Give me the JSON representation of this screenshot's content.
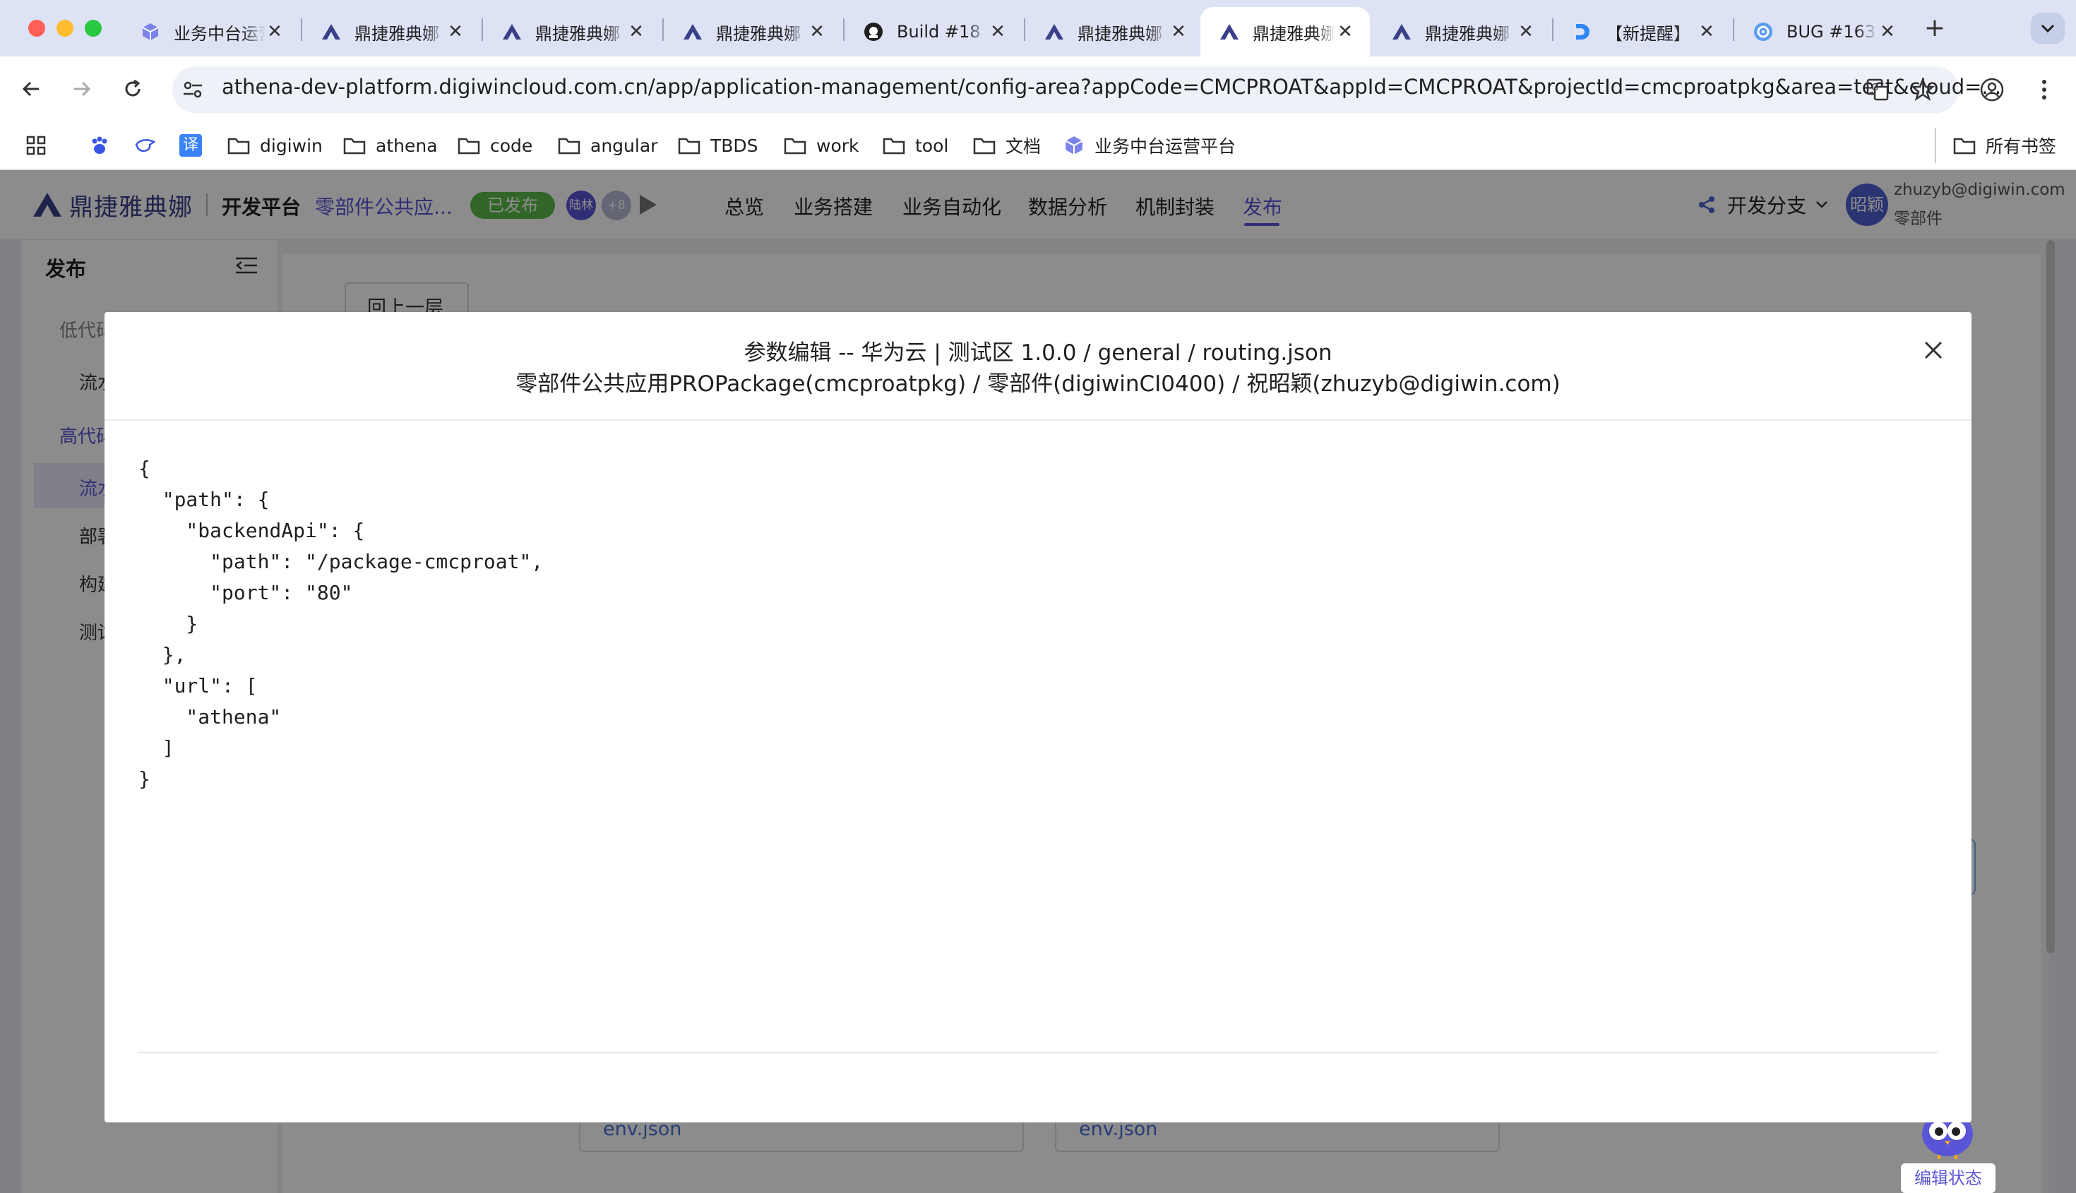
{
  "browser": {
    "tabs": [
      {
        "title": "业务中台运营平台",
        "icon": "cube-icon",
        "active": false
      },
      {
        "title": "鼎捷雅典娜",
        "icon": "athena-logo-icon",
        "active": false
      },
      {
        "title": "鼎捷雅典娜",
        "icon": "athena-logo-icon",
        "active": false
      },
      {
        "title": "鼎捷雅典娜",
        "icon": "athena-logo-icon",
        "active": false
      },
      {
        "title": "Build #18",
        "icon": "build-icon",
        "active": false
      },
      {
        "title": "鼎捷雅典娜",
        "icon": "athena-logo-icon",
        "active": false
      },
      {
        "title": "鼎捷雅典娜",
        "icon": "athena-logo-icon",
        "active": true
      },
      {
        "title": "鼎捷雅典娜",
        "icon": "athena-logo-icon",
        "active": false
      },
      {
        "title": "【新提醒】",
        "icon": "d-logo-icon",
        "active": false
      },
      {
        "title": "BUG #163",
        "icon": "bug-tracker-icon",
        "active": false
      }
    ],
    "url": "athena-dev-platform.digiwincloud.com.cn/app/application-management/config-area?appCode=CMCPROAT&appId=CMCPROAT&projectId=cmcproatpkg&area=test&cloud=...",
    "bookmarks": [
      {
        "label": "",
        "icon": "apps-grid-icon"
      },
      {
        "label": "",
        "icon": "baidu-paw-icon"
      },
      {
        "label": "",
        "icon": "bird-icon"
      },
      {
        "label": "译",
        "icon": "translate-icon"
      },
      {
        "label": "digiwin",
        "icon": "folder-icon"
      },
      {
        "label": "athena",
        "icon": "folder-icon"
      },
      {
        "label": "code",
        "icon": "folder-icon"
      },
      {
        "label": "angular",
        "icon": "folder-icon"
      },
      {
        "label": "TBDS",
        "icon": "folder-icon"
      },
      {
        "label": "work",
        "icon": "folder-icon"
      },
      {
        "label": "tool",
        "icon": "folder-icon"
      },
      {
        "label": "文档",
        "icon": "folder-icon"
      },
      {
        "label": "业务中台运营平台",
        "icon": "cube-icon"
      }
    ],
    "all_bookmarks": "所有书签"
  },
  "app": {
    "logo": "鼎捷雅典娜",
    "platform": "开发平台",
    "app_name": "零部件公共应...",
    "status_badge": "已发布",
    "avatars": [
      "陆林",
      "+8"
    ],
    "menu": [
      "总览",
      "业务搭建",
      "业务自动化",
      "数据分析",
      "机制封装",
      "发布"
    ],
    "active_menu": "发布",
    "branch_label": "开发分支",
    "user": {
      "avatar": "昭颖",
      "email": "zhuzyb@digiwin.com",
      "role": "零部件"
    }
  },
  "sidebar": {
    "title": "发布",
    "items": [
      {
        "label": "低代码",
        "type": "group"
      },
      {
        "label": "流水",
        "type": "item"
      },
      {
        "label": "高代码",
        "type": "group-active"
      },
      {
        "label": "流水",
        "type": "item-active"
      },
      {
        "label": "部署",
        "type": "item"
      },
      {
        "label": "构建",
        "type": "item"
      },
      {
        "label": "测试",
        "type": "item"
      }
    ]
  },
  "content": {
    "back_button": "回上一层",
    "env_files": [
      "env.json",
      "env.json"
    ],
    "edit_status": "编辑状态"
  },
  "modal": {
    "title": "参数编辑 -- 华为云 | 测试区 1.0.0 / general / routing.json",
    "subtitle": "零部件公共应用PROPackage(cmcproatpkg) / 零部件(digiwinCI0400) / 祝昭颖(zhuzyb@digiwin.com)",
    "code": "{\n  \"path\": {\n    \"backendApi\": {\n      \"path\": \"/package-cmcproat\",\n      \"port\": \"80\"\n    }\n  },\n  \"url\": [\n    \"athena\"\n  ]\n}"
  }
}
